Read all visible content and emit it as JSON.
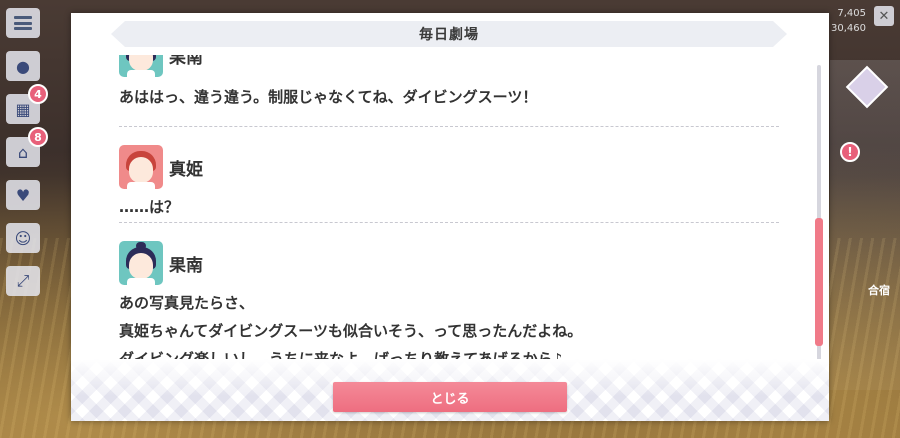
{
  "dialog": {
    "title": "毎日劇場",
    "close_label": "とじる"
  },
  "entries": [
    {
      "speaker": "果南",
      "avatar_color": "#6ec6c0",
      "lines": [
        "あははっ、違う違う。制服じゃなくてね、ダイビングスーツ！"
      ]
    },
    {
      "speaker": "真姫",
      "avatar_color": "#f08a8a",
      "lines": [
        "……は？"
      ]
    },
    {
      "speaker": "果南",
      "avatar_color": "#6ec6c0",
      "lines": [
        "あの写真見たらさ、",
        "真姫ちゃんてダイビングスーツも似合いそう、って思ったんだよね。",
        "ダイビング楽しいし、うちに来なよ。ばっちり教えてあげるから♪"
      ]
    }
  ],
  "side_menu": {
    "badges": [
      "4",
      "8"
    ]
  },
  "top_right": {
    "values": [
      "7,405",
      "30,460"
    ]
  },
  "right_panel": {
    "label": "合宿",
    "alert": "!"
  },
  "colors": {
    "accent": "#f07a88",
    "header_bg": "#eceef3"
  }
}
